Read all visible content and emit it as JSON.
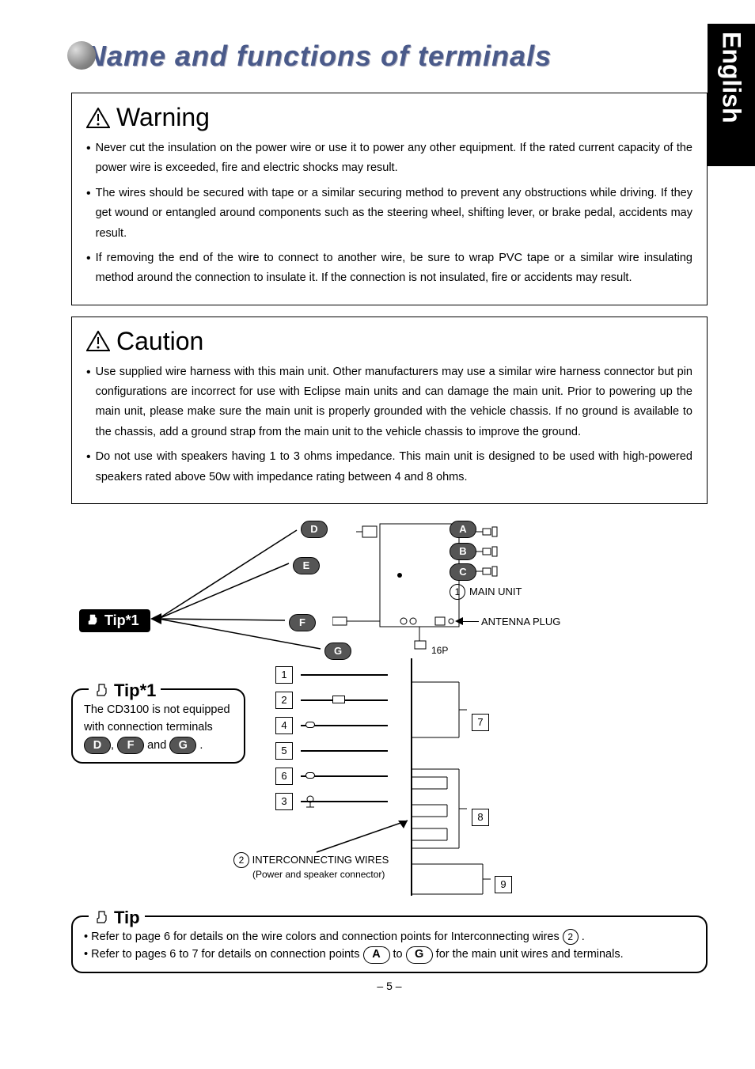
{
  "sideTab": "English",
  "title": "Name and functions of terminals",
  "warning": {
    "heading": "Warning",
    "items": [
      "Never cut the insulation on the power wire or use it to power any other equipment. If the rated current capacity of the power wire is exceeded, fire and electric shocks may result.",
      "The wires should be secured with tape or a similar securing method to prevent any obstructions while driving. If they get wound or entangled around components such as the steering wheel, shifting lever, or brake pedal, accidents may result.",
      "If removing the end of the wire to connect to another wire, be sure to wrap PVC tape or a similar wire insulating method around the connection to insulate it. If the connection is not insulated, fire or accidents may result."
    ]
  },
  "caution": {
    "heading": "Caution",
    "items": [
      "Use supplied wire harness with this main unit.  Other manufacturers may use a similar wire harness connector but pin configurations are incorrect for use with Eclipse main units and can damage the main unit.  Prior to powering up the main unit, please make sure the main unit is properly grounded with the vehicle chassis.  If no ground is available to the chassis, add a ground strap from the main unit to the vehicle chassis to improve the ground.",
      "Do not use with speakers having 1 to 3 ohms impedance.  This main unit is designed to be used with high-powered speakers rated above 50w with impedance rating between 4 and 8 ohms."
    ]
  },
  "diagram": {
    "tipBadge": "Tip*1",
    "labels": {
      "A": "A",
      "B": "B",
      "C": "C",
      "D": "D",
      "E": "E",
      "F": "F",
      "G": "G"
    },
    "annotations": {
      "mainUnit": "MAIN UNIT",
      "antennaPlug": "ANTENNA PLUG",
      "connector": "16P",
      "interconnectingTitle": "INTERCONNECTING WIRES",
      "interconnectingSub": "(Power and speaker connector)"
    },
    "tipBox1": {
      "legend": "Tip*1",
      "textPrefix": "The CD3100 is not equipped with connection terminals ",
      "midJoin": ", ",
      "andWord": " and ",
      "period": " ."
    },
    "tipBox2": {
      "legend": "Tip",
      "line1a": "Refer to page 6 for details on the wire colors and connection points for Interconnecting wires ",
      "line1b": " .",
      "line2a": "Refer to pages 6 to 7 for details on connection points ",
      "toWord": " to ",
      "line2b": " for the main unit wires and terminals."
    }
  },
  "pageNumber": "– 5 –"
}
